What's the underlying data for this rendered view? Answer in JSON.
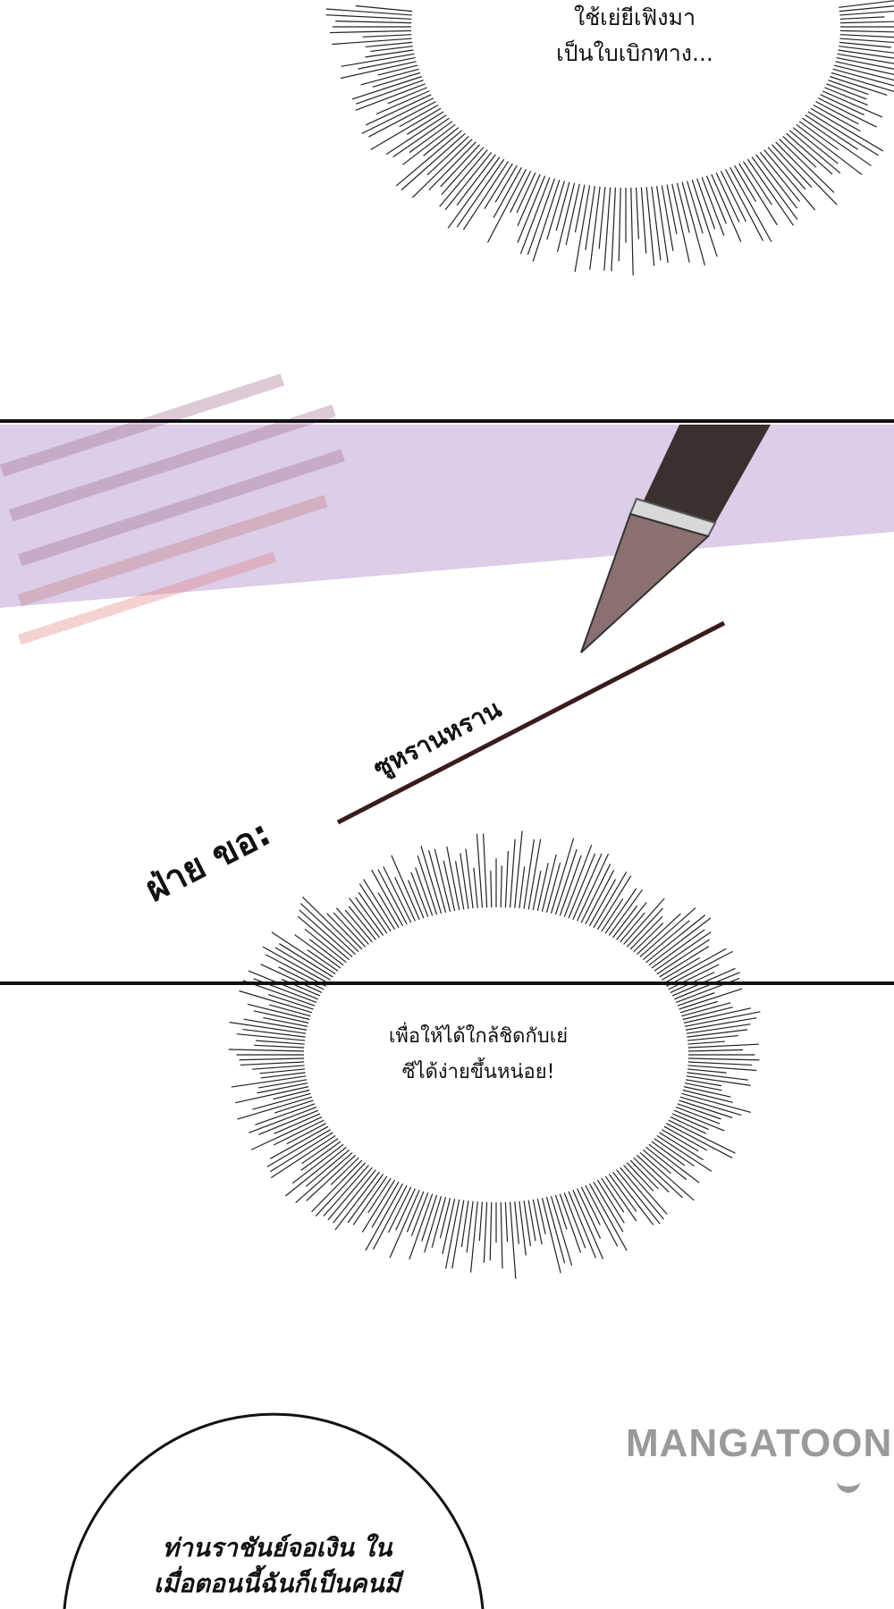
{
  "bubbles": {
    "top": {
      "line1": "ใช้เย่ยีเฟิงมา",
      "line2": "เป็นใบเบิกทาง..."
    },
    "middle": {
      "line1": "เพื่อให้ได้ใกล้ชิดกับเย่",
      "line2": "ซีได้ง่ายขึ้นหน่อย!"
    },
    "bottom": {
      "line1": "ท่านราชันย์จอเงิน ใน",
      "line2": "เมื่อตอนนี้ฉันก็เป็นคนมี"
    }
  },
  "document": {
    "party_label": "ฝ่าย ขอ:",
    "signature": "ซูหรานหราน"
  },
  "watermark": "MANGATOON",
  "colors": {
    "purple": "#d9c9e6",
    "ink": "#3a1c1c"
  }
}
